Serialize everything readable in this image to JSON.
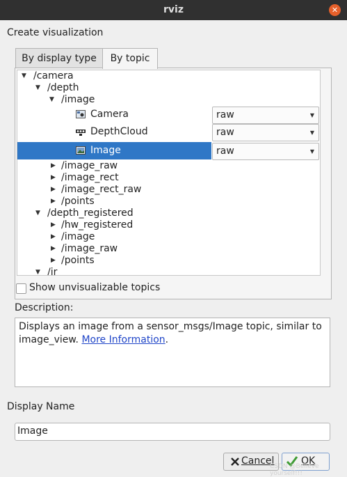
{
  "window": {
    "title": "rviz"
  },
  "header": {
    "create_label": "Create visualization"
  },
  "tabs": [
    {
      "label": "By display type"
    },
    {
      "label": "By topic"
    }
  ],
  "tree": {
    "rows": [
      {
        "label": "/camera"
      },
      {
        "label": "/depth"
      },
      {
        "label": "/image"
      },
      {
        "label": "Camera",
        "option": "raw"
      },
      {
        "label": "DepthCloud",
        "option": "raw"
      },
      {
        "label": "Image",
        "option": "raw"
      },
      {
        "label": "/image_raw"
      },
      {
        "label": "/image_rect"
      },
      {
        "label": "/image_rect_raw"
      },
      {
        "label": "/points"
      },
      {
        "label": "/depth_registered"
      },
      {
        "label": "/hw_registered"
      },
      {
        "label": "/image"
      },
      {
        "label": "/image_raw"
      },
      {
        "label": "/points"
      },
      {
        "label": "/ir"
      }
    ],
    "selected": "Image"
  },
  "show_unvisualizable": {
    "label": "Show unvisualizable topics",
    "checked": false
  },
  "description": {
    "label": "Description:",
    "text": "Displays an image from a sensor_msgs/Image topic, similar to image_view.",
    "link": "More Information",
    "suffix": "."
  },
  "display_name": {
    "label": "Display Name",
    "value": "Image"
  },
  "buttons": {
    "cancel": "Cancel",
    "ok": "OK"
  },
  "watermark": "CSDN @Believe yourself!!!",
  "colors": {
    "selection": "#2f77c6",
    "titlebar": "#303030",
    "close": "#e6602b",
    "link": "#1f45c8"
  }
}
